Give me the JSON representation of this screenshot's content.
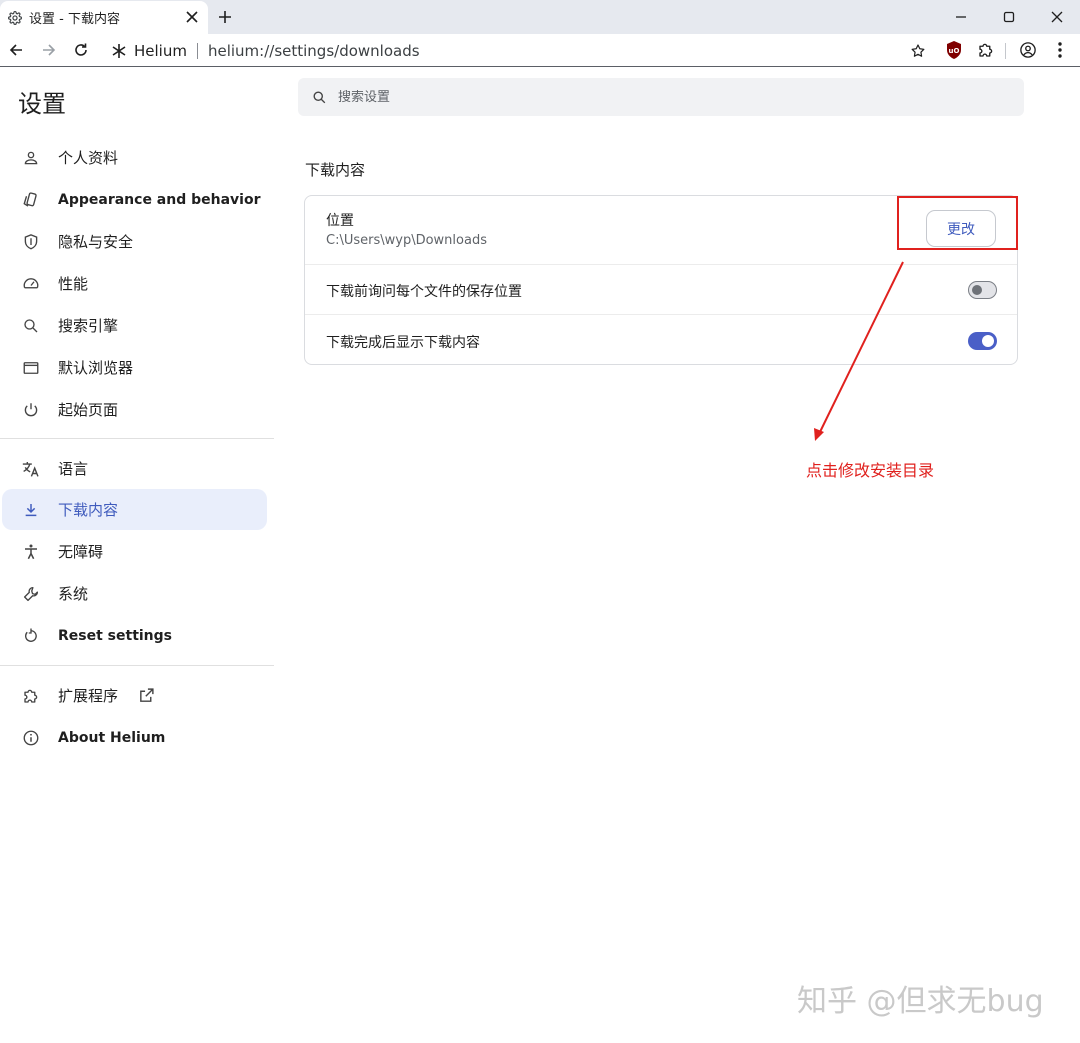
{
  "tab": {
    "title": "设置 - 下载内容",
    "favicon": "gear-icon",
    "close": "close-icon",
    "new_tab": "plus-icon"
  },
  "window_controls": [
    "minimize-icon",
    "maximize-icon",
    "close-icon"
  ],
  "toolbar": {
    "back": "arrow-left-icon",
    "forward": "arrow-right-icon",
    "reload": "reload-icon",
    "site_icon": "asterisk-icon",
    "site_name": "Helium",
    "url": "helium://settings/downloads",
    "bookmark": "star-icon",
    "extensions": [
      "ublock-icon",
      "puzzle-icon"
    ],
    "profile": "account-circle-icon",
    "menu": "more-vert-icon"
  },
  "sidebar": {
    "title": "设置",
    "items": [
      {
        "label": "个人资料",
        "icon": "person-icon"
      },
      {
        "label": "Appearance and behavior",
        "icon": "palette-icon"
      },
      {
        "label": "隐私与安全",
        "icon": "shield-icon"
      },
      {
        "label": "性能",
        "icon": "speedometer-icon"
      },
      {
        "label": "搜索引擎",
        "icon": "search-icon"
      },
      {
        "label": "默认浏览器",
        "icon": "browser-window-icon"
      },
      {
        "label": "起始页面",
        "icon": "power-icon"
      },
      {
        "label": "语言",
        "icon": "translate-icon"
      },
      {
        "label": "下载内容",
        "icon": "download-icon",
        "active": true
      },
      {
        "label": "无障碍",
        "icon": "accessibility-icon"
      },
      {
        "label": "系统",
        "icon": "wrench-icon"
      },
      {
        "label": "Reset settings",
        "icon": "restore-icon"
      },
      {
        "label": "扩展程序",
        "icon": "puzzle-icon",
        "trailing_icon": "open-external-icon"
      },
      {
        "label": "About Helium",
        "icon": "info-icon"
      }
    ]
  },
  "search": {
    "placeholder": "搜索设置",
    "icon": "search-icon"
  },
  "downloads": {
    "section_title": "下载内容",
    "location_label": "位置",
    "location_path": "C:\\Users\\wyp\\Downloads",
    "change_button": "更改",
    "ask_label": "下载前询问每个文件的保存位置",
    "ask_enabled": false,
    "show_label": "下载完成后显示下载内容",
    "show_enabled": true
  },
  "annotation": {
    "text": "点击修改安装目录",
    "color": "#e0211e"
  },
  "watermark": "知乎 @但求无bug",
  "colors": {
    "accent": "#3f5bbd",
    "toggle_on": "#4a5fc7",
    "annotation_red": "#e0211e",
    "active_nav_bg": "#e9eefb"
  }
}
